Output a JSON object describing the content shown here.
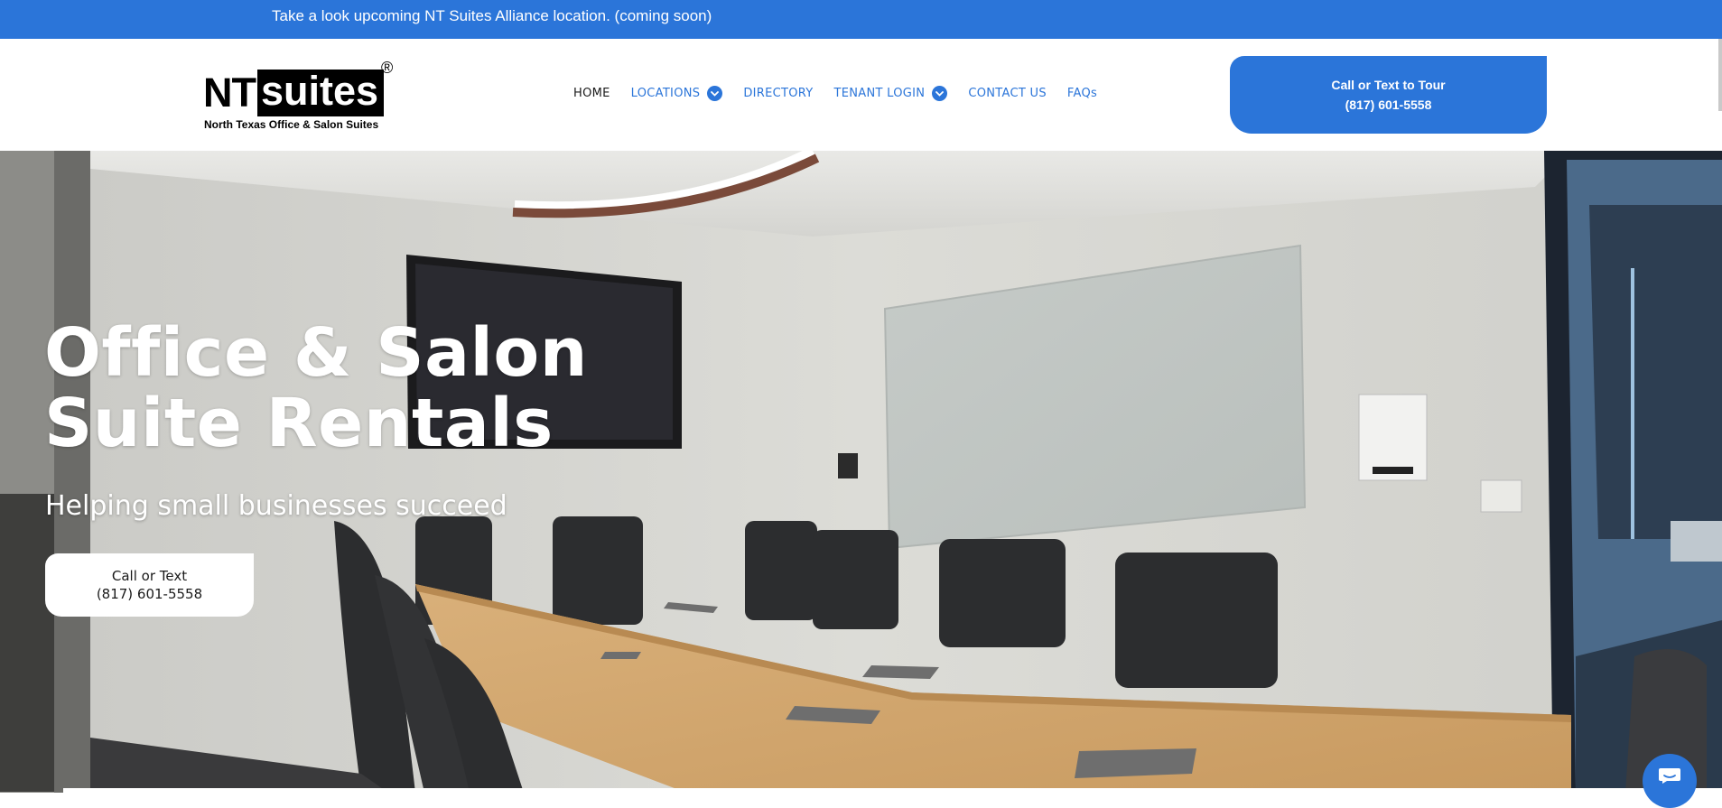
{
  "announcement": {
    "text": "Take a look upcoming NT Suites Alliance location. (coming soon)"
  },
  "logo": {
    "nt": "NT",
    "suites": "suites",
    "registered": "®",
    "tagline": "North Texas Office & Salon Suites"
  },
  "nav": {
    "home": "HOME",
    "locations": "LOCATIONS",
    "directory": "DIRECTORY",
    "tenant_login": "TENANT LOGIN",
    "contact_us": "CONTACT US",
    "faqs": "FAQs"
  },
  "tour_button": {
    "line1": "Call or Text to Tour",
    "line2": "(817) 601-5558"
  },
  "hero": {
    "title_line1": "Office & Salon",
    "title_line2": "Suite Rentals",
    "subtitle": "Helping small businesses succeed",
    "button_line1": "Call or Text",
    "button_line2": "(817) 601-5558"
  },
  "colors": {
    "brand_blue": "#2b75d9",
    "text_dark": "#1a1a1a",
    "white": "#ffffff"
  },
  "icons": {
    "chevron": "chevron-down-icon",
    "chat": "chat-icon"
  }
}
